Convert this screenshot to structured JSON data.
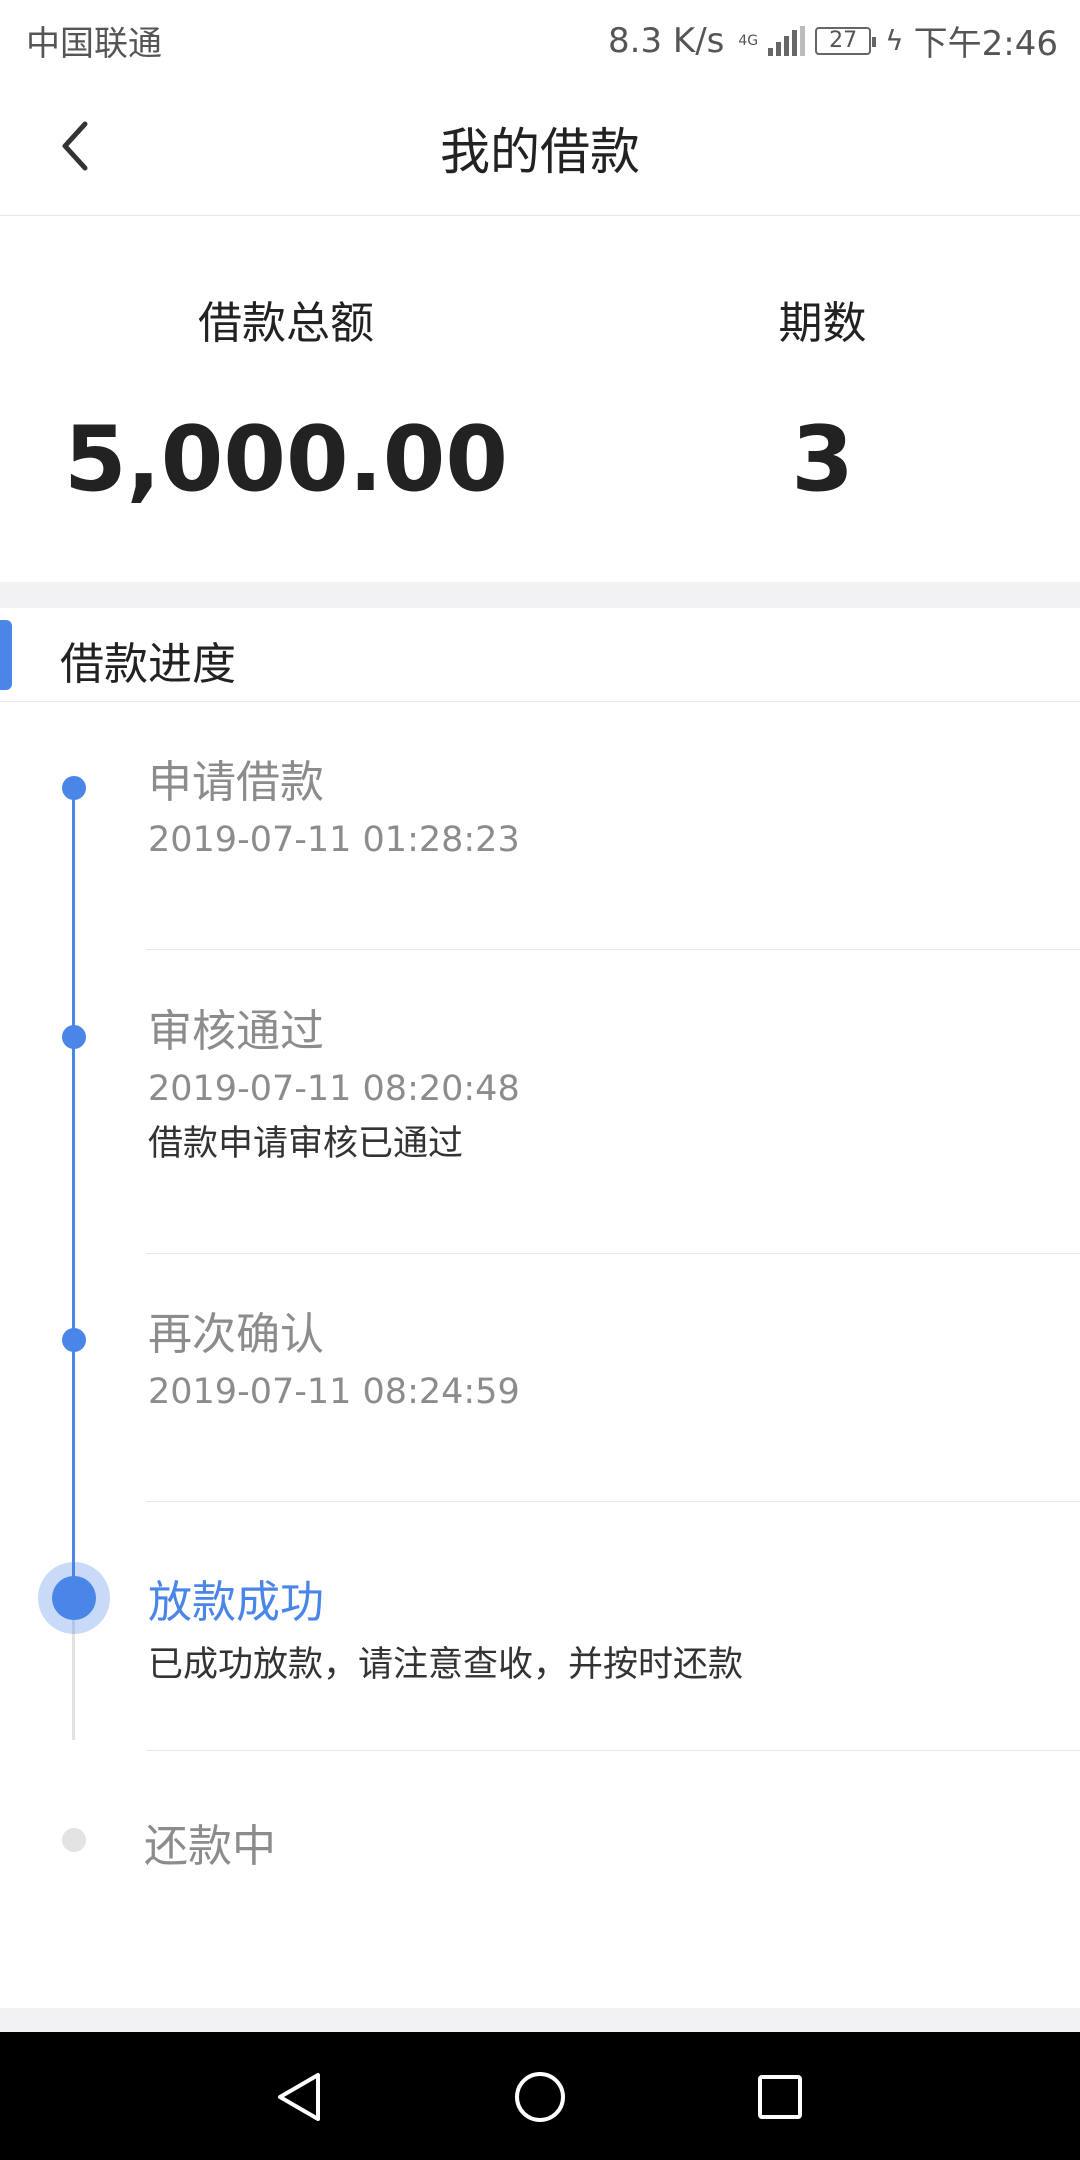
{
  "status_bar": {
    "carrier": "中国联通",
    "speed": "8.3 K/s",
    "network": "4G",
    "battery": "27",
    "time": "下午2:46"
  },
  "header": {
    "title": "我的借款"
  },
  "summary": {
    "total_label": "借款总额",
    "total_value": "5,000.00",
    "periods_label": "期数",
    "periods_value": "3"
  },
  "progress": {
    "section_title": "借款进度",
    "steps": [
      {
        "title": "申请借款",
        "time": "2019-07-11 01:28:23",
        "desc": ""
      },
      {
        "title": "审核通过",
        "time": "2019-07-11 08:20:48",
        "desc": "借款申请审核已通过"
      },
      {
        "title": "再次确认",
        "time": "2019-07-11 08:24:59",
        "desc": ""
      },
      {
        "title": "放款成功",
        "time": "",
        "desc": "已成功放款，请注意查收，并按时还款"
      },
      {
        "title": "还款中",
        "time": "",
        "desc": ""
      }
    ]
  },
  "colors": {
    "accent": "#4a86e8",
    "muted": "#8c8c8c",
    "pending": "#e3e3e3"
  },
  "icons": {
    "back": "chevron-left-icon",
    "nav_back": "triangle-back-icon",
    "nav_home": "circle-home-icon",
    "nav_recents": "square-recents-icon"
  }
}
